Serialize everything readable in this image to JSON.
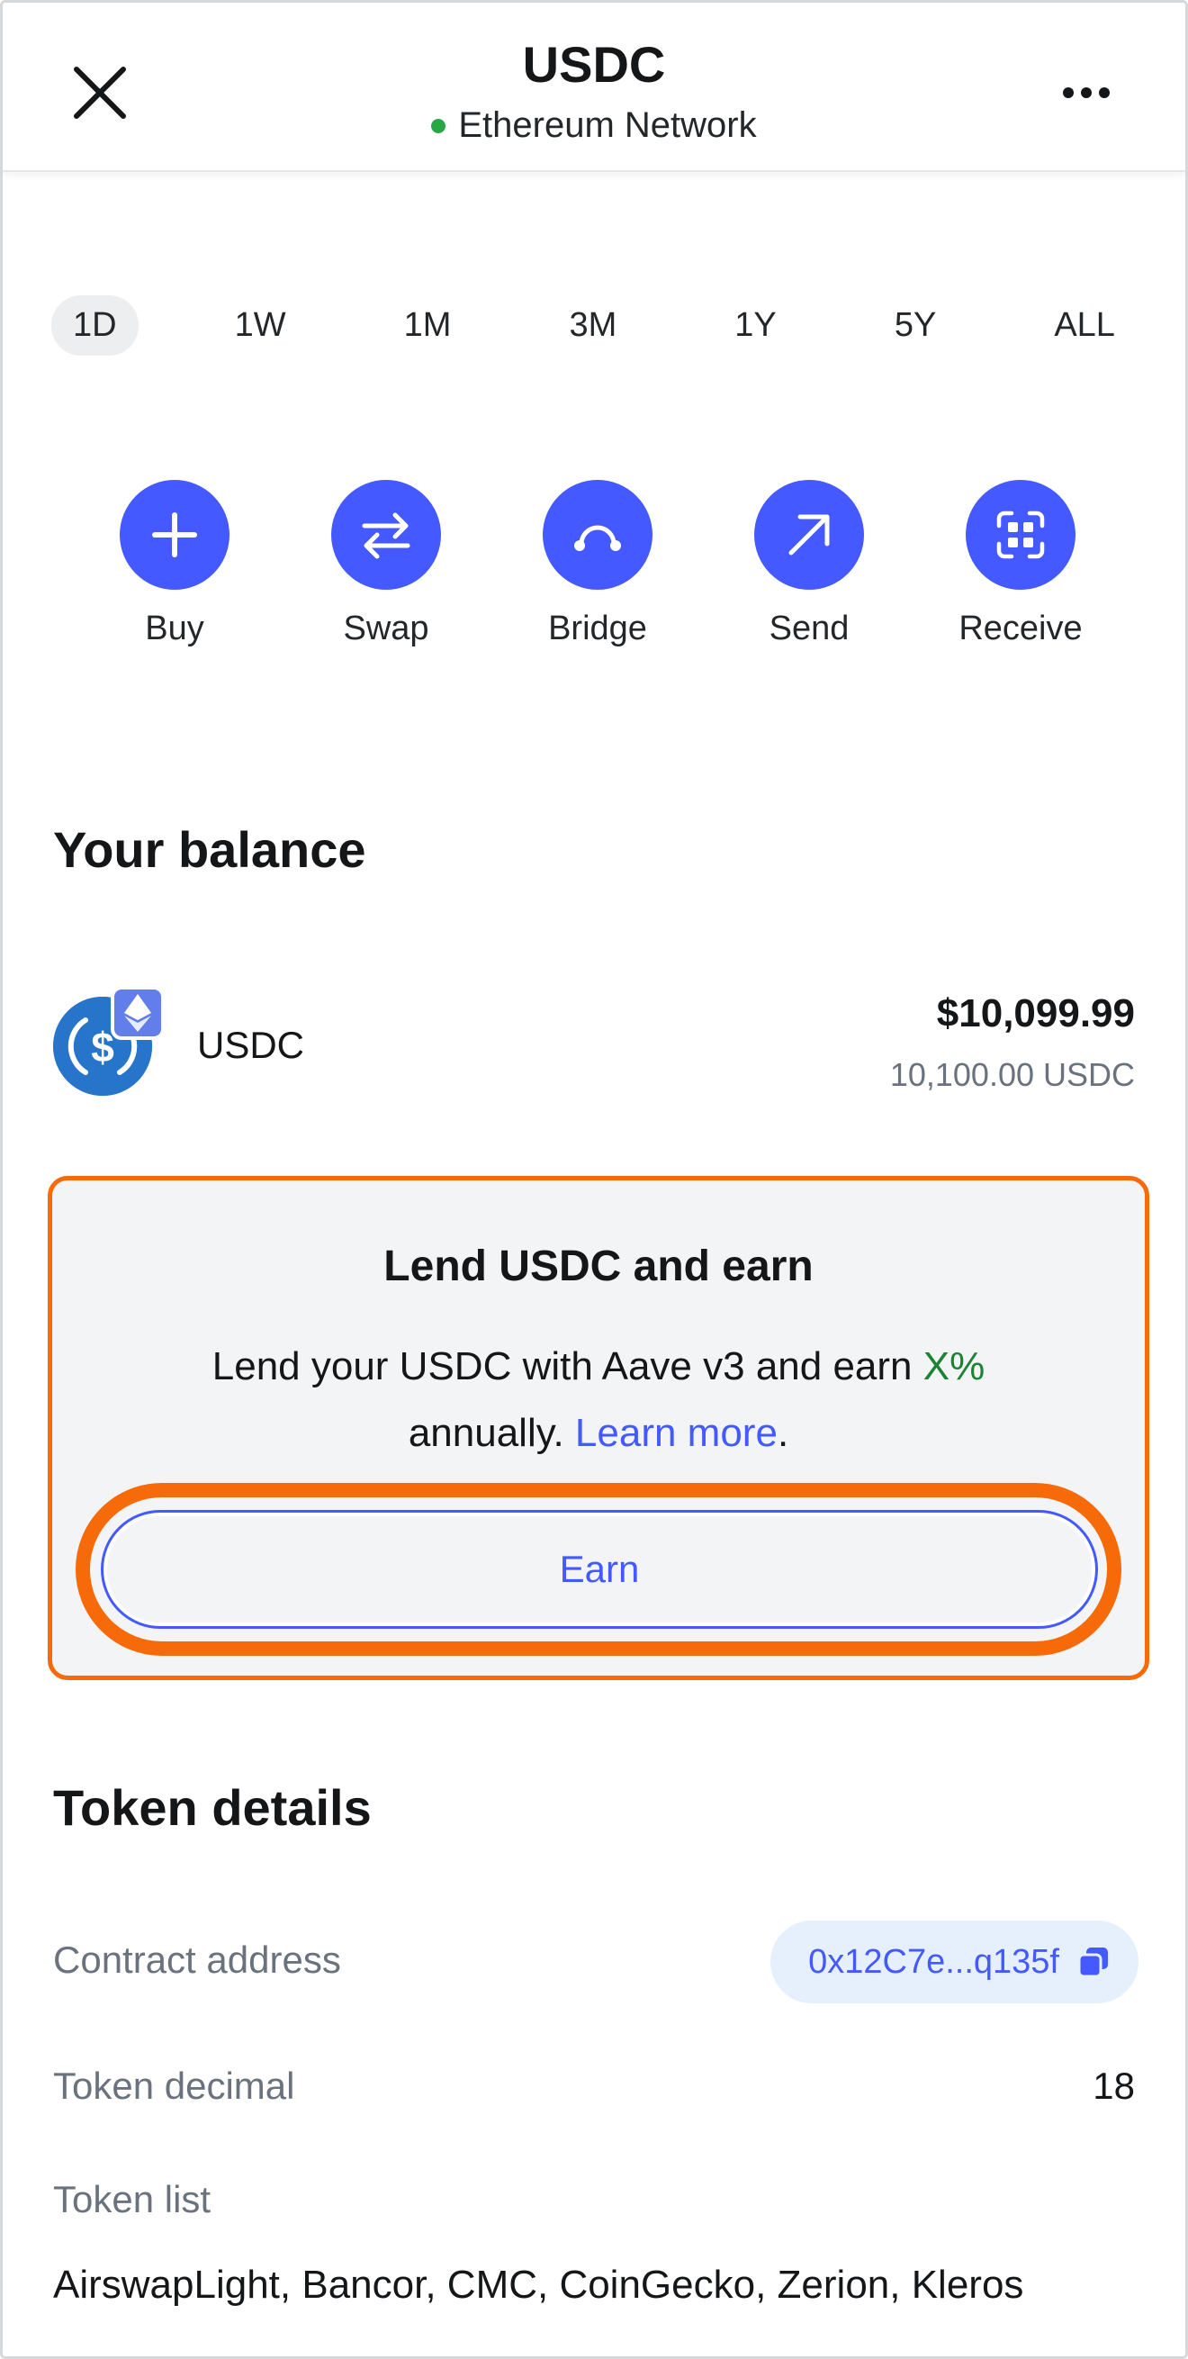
{
  "header": {
    "title": "USDC",
    "network": "Ethereum Network",
    "network_status_color": "#28a745"
  },
  "time_ranges": {
    "selected": "1D",
    "items": [
      "1D",
      "1W",
      "1M",
      "3M",
      "1Y",
      "5Y",
      "ALL"
    ]
  },
  "actions": [
    {
      "label": "Buy",
      "icon": "plus-icon"
    },
    {
      "label": "Swap",
      "icon": "swap-arrows-icon"
    },
    {
      "label": "Bridge",
      "icon": "bridge-icon"
    },
    {
      "label": "Send",
      "icon": "arrow-up-right-icon"
    },
    {
      "label": "Receive",
      "icon": "qr-code-icon"
    }
  ],
  "balance": {
    "section_title": "Your balance",
    "token_name": "USDC",
    "fiat_value": "$10,099.99",
    "token_amount": "10,100.00 USDC"
  },
  "earn": {
    "title": "Lend USDC and earn",
    "desc_before": "Lend your USDC with Aave v3 and earn ",
    "apr": "X%",
    "desc_middle": " annually. ",
    "learn_more": "Learn more",
    "desc_end": ".",
    "button_label": "Earn"
  },
  "token_details": {
    "section_title": "Token details",
    "contract_label": "Contract address",
    "contract_value": "0x12C7e...q135f",
    "decimal_label": "Token decimal",
    "decimal_value": "18",
    "list_label": "Token list",
    "list_value": "AirswapLight, Bancor, CMC, CoinGecko, Zerion, Kleros"
  },
  "colors": {
    "accent": "#4459ff",
    "highlight": "#f66a0a",
    "usdc_blue": "#2775ca",
    "eth_badge": "#627eea",
    "success": "#1c8234"
  }
}
